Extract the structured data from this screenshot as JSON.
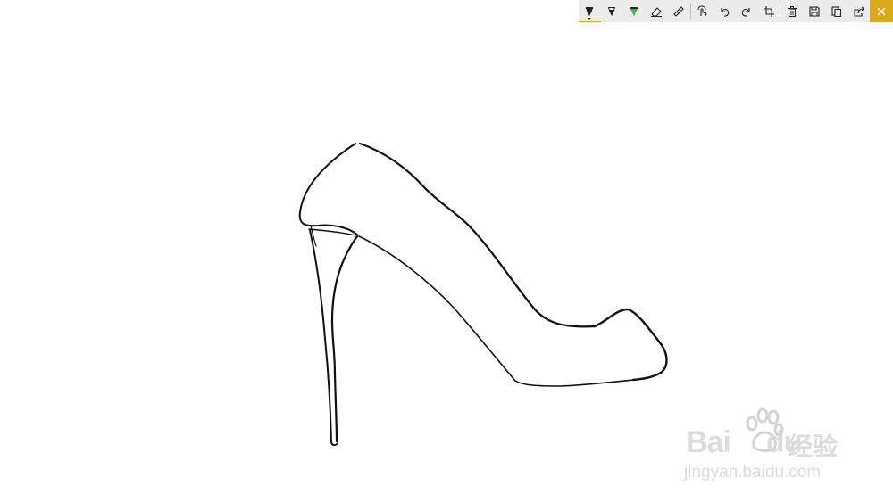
{
  "toolbar": {
    "tools": [
      {
        "icon": "ballpoint-pen-icon",
        "active": true
      },
      {
        "icon": "pencil-icon",
        "active": false
      },
      {
        "icon": "highlighter-icon",
        "active": false
      },
      {
        "icon": "eraser-icon",
        "active": false
      },
      {
        "icon": "ruler-icon",
        "active": false
      }
    ],
    "actions": [
      {
        "icon": "touch-writing-icon"
      },
      {
        "icon": "undo-icon"
      },
      {
        "icon": "redo-icon"
      },
      {
        "icon": "crop-icon"
      }
    ],
    "file_actions": [
      {
        "icon": "delete-icon"
      },
      {
        "icon": "save-icon"
      },
      {
        "icon": "copy-icon"
      },
      {
        "icon": "share-icon"
      }
    ],
    "close_icon": "close-icon",
    "accent_color": "#d9a91a",
    "highlighter_color": "#3fb83f"
  },
  "canvas": {
    "subject": "high-heel-shoe-sketch",
    "ink_color": "#111111"
  },
  "watermark": {
    "brand": "Bai",
    "brand_suffix": "du",
    "cn_text": "经验",
    "url": "jingyan.baidu.com"
  }
}
